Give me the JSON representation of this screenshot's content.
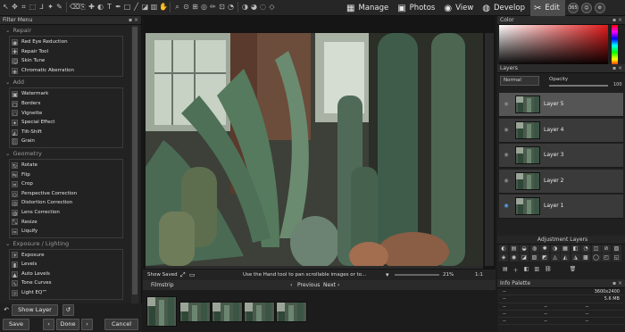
{
  "toolbar": {
    "tools": [
      "select-tool",
      "move-tool",
      "crop-tool",
      "marquee-tool",
      "lasso-tool",
      "magic-wand-tool",
      "brush-tool",
      "eraser-tool",
      "clone-tool",
      "heal-tool",
      "dodge-tool",
      "text-tool",
      "pen-tool",
      "shape-tool",
      "line-tool",
      "fill-tool",
      "gradient-tool",
      "hand-tool",
      "zoom-tool",
      "eyedropper-tool",
      "measure-tool",
      "redeye-tool",
      "pencil-tool",
      "stamp-tool",
      "smudge-tool",
      "sponge-tool",
      "burn-tool",
      "blur-tool",
      "sharpen-tool"
    ],
    "modes": [
      {
        "label": "Manage",
        "icon": "grid-icon"
      },
      {
        "label": "Photos",
        "icon": "image-icon"
      },
      {
        "label": "View",
        "icon": "eye-icon"
      },
      {
        "label": "Develop",
        "icon": "camera-icon"
      },
      {
        "label": "Edit",
        "icon": "scissors-icon"
      }
    ],
    "badge": "365"
  },
  "filter_menu": {
    "title": "Filter Menu",
    "categories": [
      {
        "name": "Repair",
        "items": [
          "Red Eye Reduction",
          "Repair Tool",
          "Skin Tune",
          "Chromatic Aberration"
        ]
      },
      {
        "name": "Add",
        "items": [
          "Watermark",
          "Borders",
          "Vignette",
          "Special Effect",
          "Tilt-Shift",
          "Grain"
        ]
      },
      {
        "name": "Geometry",
        "items": [
          "Rotate",
          "Flip",
          "Crop",
          "Perspective Correction",
          "Distortion Correction",
          "Lens Correction",
          "Resize",
          "Liquify"
        ]
      },
      {
        "name": "Exposure / Lighting",
        "items": [
          "Exposure",
          "Levels",
          "Auto Levels",
          "Tone Curves",
          "Light EQ™"
        ]
      }
    ]
  },
  "bottom": {
    "show_layer": "Show Layer",
    "save": "Save",
    "done": "Done",
    "cancel": "Cancel"
  },
  "status": {
    "show_saved": "Show Saved",
    "hint": "Use the Hand tool to pan scrollable images or to...",
    "zoom": "21%",
    "ratio": "1:1"
  },
  "filmstrip": {
    "title": "Filmstrip",
    "previous": "Previous",
    "next": "Next",
    "thumb_count": 5
  },
  "color": {
    "title": "Color"
  },
  "layers": {
    "title": "Layers",
    "blend_mode": "Normal",
    "opacity_label": "Opacity",
    "opacity_value": "100",
    "items": [
      "Layer 5",
      "Layer 4",
      "Layer 3",
      "Layer 2",
      "Layer 1"
    ]
  },
  "adjustments": {
    "title": "Adjustment Layers"
  },
  "info": {
    "title": "Info Palette",
    "dimensions": "3600x2400",
    "size": "5.6 MB",
    "placeholder": "--"
  }
}
